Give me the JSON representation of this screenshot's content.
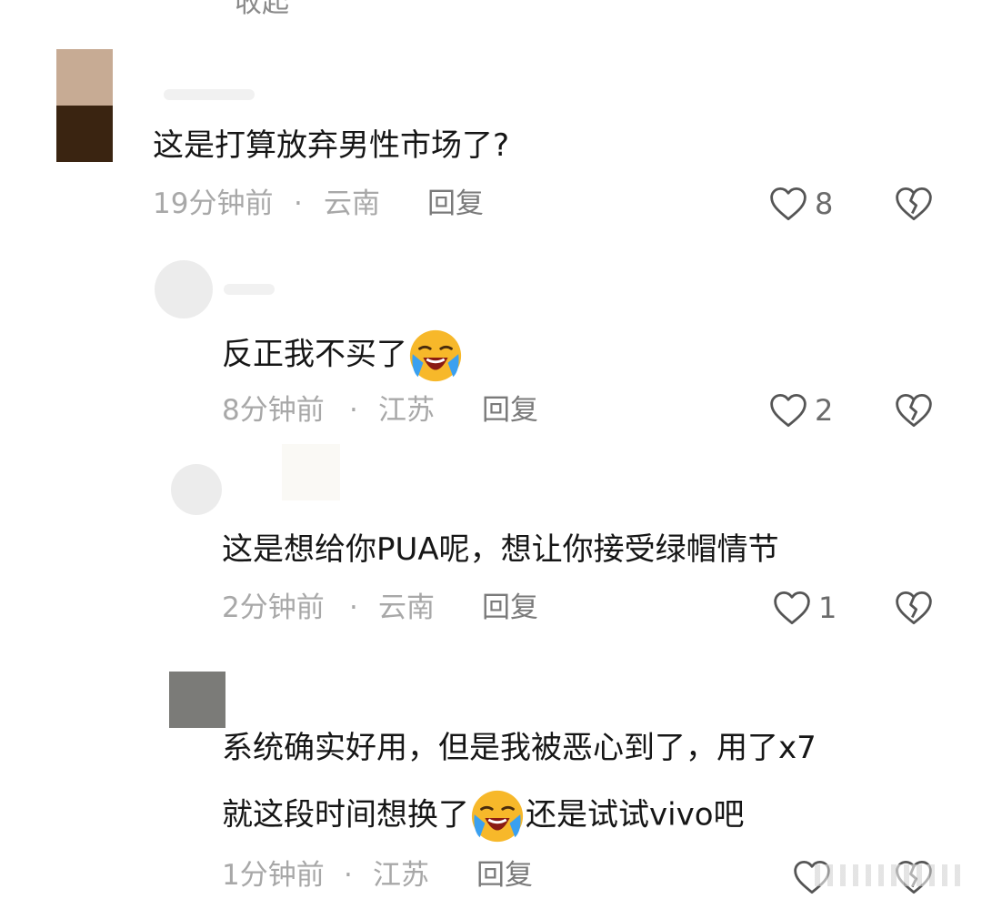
{
  "top_fragment": "收起",
  "comments": [
    {
      "text": "这是打算放弃男性市场了?",
      "time": "19分钟前",
      "location": "云南",
      "reply": "回复",
      "likes": "8"
    },
    {
      "text": "反正我不买了",
      "emoji": "loudly-crying-face",
      "time": "8分钟前",
      "location": "江苏",
      "reply": "回复",
      "likes": "2"
    },
    {
      "text": "这是想给你PUA呢，想让你接受绿帽情节",
      "time": "2分钟前",
      "location": "云南",
      "reply": "回复",
      "likes": "1"
    },
    {
      "line1": "系统确实好用，但是我被恶心到了，用了x7",
      "line2_a": "就这段时间想换了",
      "line2_emoji": "loudly-crying-face",
      "line2_b": "还是试试vivo吧",
      "time": "1分钟前",
      "location": "江苏",
      "reply": "回复"
    }
  ],
  "separator": "·",
  "colors": {
    "text": "#161616",
    "meta": "#a8a8a8",
    "icon": "#555555"
  }
}
